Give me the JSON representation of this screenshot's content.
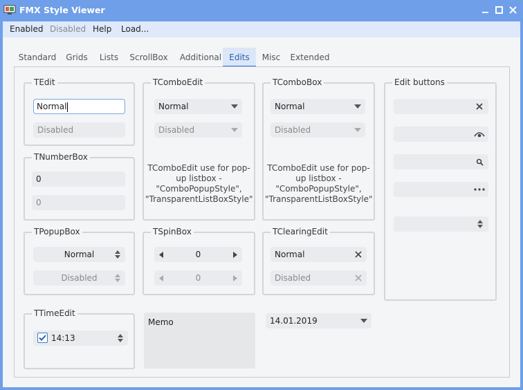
{
  "window": {
    "title": "FMX Style Viewer"
  },
  "menu": [
    "Enabled",
    "Disabled",
    "Help",
    "Load..."
  ],
  "tabs": [
    "Standard",
    "Grids",
    "Lists",
    "ScrollBox",
    "Additional",
    "Edits",
    "Misc",
    "Extended"
  ],
  "active_tab": "Edits",
  "tedit": {
    "label": "TEdit",
    "normal": "Normal",
    "disabled": "Disabled"
  },
  "tcomboedit": {
    "label": "TComboEdit",
    "normal": "Normal",
    "disabled": "Disabled",
    "note": "TComboEdit use for pop-up listbox - \"ComboPopupStyle\", \"TransparentListBoxStyle\""
  },
  "tcombobox": {
    "label": "TComboBox",
    "normal": "Normal",
    "disabled": "Disabled",
    "note": "TComboEdit use for pop-up listbox - \"ComboPopupStyle\", \"TransparentListBoxStyle\""
  },
  "edit_buttons": {
    "label": "Edit buttons"
  },
  "tnumberbox": {
    "label": "TNumberBox",
    "value1": "0",
    "value2": "0"
  },
  "tpopupbox": {
    "label": "TPopupBox",
    "normal": "Normal",
    "disabled": "Disabled"
  },
  "tspinbox": {
    "label": "TSpinBox",
    "value1": "0",
    "value2": "0"
  },
  "tclearingedit": {
    "label": "TClearingEdit",
    "normal": "Normal",
    "disabled": "Disabled"
  },
  "ttimeedit": {
    "label": "TTimeEdit",
    "time": "14:13",
    "checked": true
  },
  "memo": {
    "text": "Memo"
  },
  "dateedit": {
    "value": "14.01.2019"
  },
  "colors": {
    "titlebar": "#6f9fe8",
    "menubar": "#dfe9fb",
    "accent": "#3b7bd5",
    "field": "#e9ebee"
  }
}
